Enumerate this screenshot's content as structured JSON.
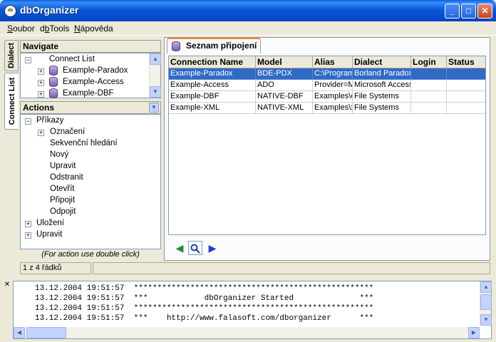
{
  "window": {
    "title": "dbOrganizer",
    "icon_label": "db"
  },
  "titlebar_buttons": {
    "minimize": "_",
    "maximize": "□",
    "close": "✕"
  },
  "menu": [
    "Soubor",
    "dbTools",
    "Nápověda"
  ],
  "menu_underline": [
    "S",
    "b",
    "N"
  ],
  "side_tabs": {
    "dialect": "Dialect",
    "connect_list": "Connect List"
  },
  "navigate": {
    "header": "Navigate",
    "root": "Connect List",
    "items": [
      "Example-Paradox",
      "Example-Access",
      "Example-DBF"
    ]
  },
  "actions": {
    "header": "Actions",
    "groups": [
      {
        "label": "Příkazy",
        "expanded": true
      },
      {
        "label": "Uložení",
        "expanded": false
      },
      {
        "label": "Upravit",
        "expanded": false
      }
    ],
    "commands": [
      "Označení",
      "Sekvenční hledání",
      "Nový",
      "Upravit",
      "Odstranit",
      "Otevřít",
      "Připojit",
      "Odpojit"
    ],
    "hint": "(For action use double click)"
  },
  "main_tab": {
    "label": "Seznam připojení"
  },
  "grid": {
    "columns": [
      "Connection Name",
      "Model",
      "Alias",
      "Dialect",
      "Login",
      "Status"
    ],
    "rows": [
      [
        "Example-Paradox",
        "BDE-PDX",
        "C:\\Program",
        "Borland Paradox",
        "",
        ""
      ],
      [
        "Example-Access",
        "ADO",
        "Provider=M",
        "Microsoft Access",
        "",
        ""
      ],
      [
        "Example-DBF",
        "NATIVE-DBF",
        "Examples\\c",
        "File Systems",
        "",
        ""
      ],
      [
        "Example-XML",
        "NATIVE-XML",
        "Examples\\x",
        "File Systems",
        "",
        ""
      ]
    ],
    "selected_row": 0
  },
  "nav_buttons": {
    "prev": "◀",
    "search": "search-icon",
    "next": "▶"
  },
  "status": {
    "rows": "1 z 4 řádků"
  },
  "log": [
    "13.12.2004 19:51:57  ***************************************************",
    "13.12.2004 19:51:57  ***            dbOrganizer Started              ***",
    "13.12.2004 19:51:57  ***************************************************",
    "13.12.2004 19:51:57  ***    http://www.falasoft.com/dborganizer      ***"
  ],
  "colors": {
    "selection": "#316ac5",
    "title_bar": "#0a58d8",
    "window_bg": "#ece9d8"
  }
}
